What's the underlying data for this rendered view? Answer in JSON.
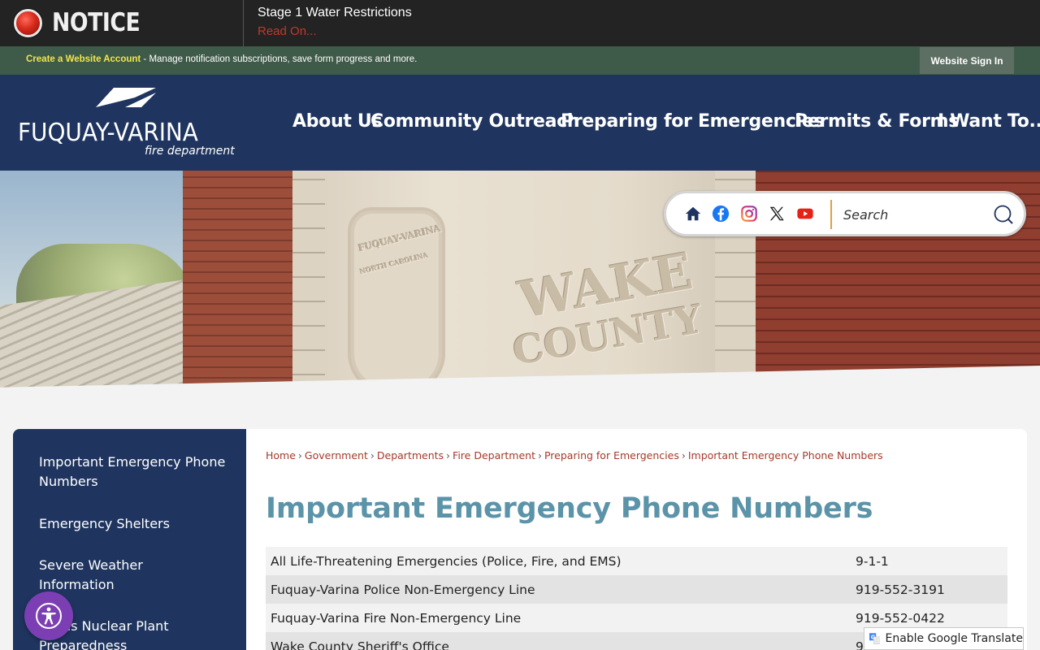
{
  "notice": {
    "title": "NOTICE",
    "message": "Stage 1 Water Restrictions",
    "link": "Read On..."
  },
  "account_bar": {
    "link": "Create a Website Account",
    "text": " - Manage notification subscriptions, save form progress and more.",
    "signin": "Website Sign In"
  },
  "logo": {
    "name": "FUQUAY-VARINA",
    "sub": "fire department"
  },
  "nav": {
    "items": [
      "About Us",
      "Community Outreach",
      "Preparing for Emergencies",
      "Permits & Forms",
      "I Want To..."
    ]
  },
  "search": {
    "placeholder": "Search"
  },
  "social": [
    "home-icon",
    "facebook-icon",
    "instagram-icon",
    "x-icon",
    "youtube-icon"
  ],
  "sidebar": {
    "items": [
      {
        "label": "Important Emergency Phone Numbers"
      },
      {
        "label": "Emergency Shelters"
      },
      {
        "label": "Severe Weather Information"
      },
      {
        "label": "Harris Nuclear Plant Preparedness"
      }
    ]
  },
  "breadcrumb": {
    "items": [
      "Home",
      "Government",
      "Departments",
      "Fire Department",
      "Preparing for Emergencies",
      "Important Emergency Phone Numbers"
    ],
    "separator": "›"
  },
  "page": {
    "title": "Important Emergency Phone Numbers"
  },
  "phones": [
    {
      "name": "All Life-Threatening Emergencies (Police, Fire, and EMS)",
      "number": "9-1-1"
    },
    {
      "name": "Fuquay-Varina Police Non-Emergency Line",
      "number": "919-552-3191"
    },
    {
      "name": "Fuquay-Varina Fire Non-Emergency Line",
      "number": "919-552-0422"
    },
    {
      "name": "Wake County Sheriff's Office",
      "number": "9"
    }
  ],
  "hero_text": {
    "seal_top": "FUQUAY-VARINA",
    "seal_mid": "NORTH CAROLINA",
    "wake": "WAKE",
    "county": "COUNTY"
  },
  "translate": {
    "label": "Enable Google Translate"
  },
  "colors": {
    "header": "#1f3560",
    "account_bar": "#3e5a48",
    "title": "#5b93a9",
    "breadcrumb_link": "#a43a2a",
    "notice_link": "#c0392b",
    "accessibility": "#7b3fb3"
  }
}
